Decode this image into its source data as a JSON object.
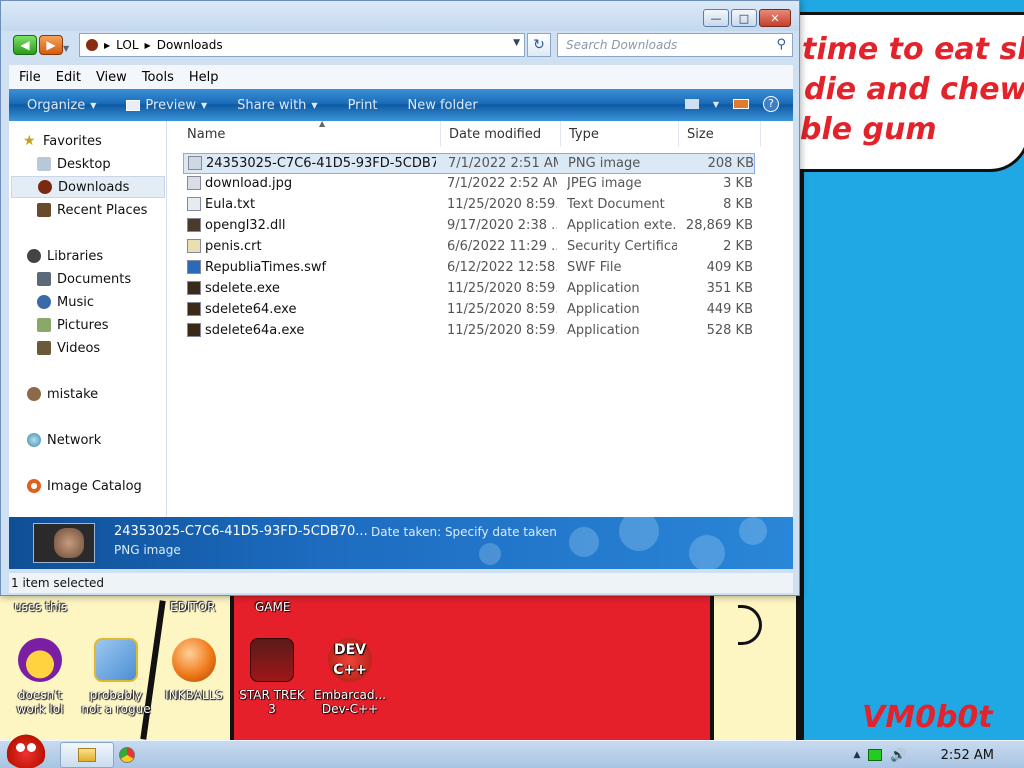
{
  "wallpaper": {
    "top_text": [
      "time to eat shit",
      "die and chew",
      "ble gum"
    ],
    "signature": "VM0b0t",
    "captions": [
      "uses this",
      "EDITOR",
      "GAME"
    ]
  },
  "desktop_icons": [
    {
      "label_lines": [
        "doesn't",
        "work lol"
      ],
      "icon": "yahoo-messenger-icon",
      "color": "#7a1fa3"
    },
    {
      "label_lines": [
        "probably",
        "not a rogue"
      ],
      "icon": "gears-monitor-icon",
      "color": "#4a8fd4"
    },
    {
      "label_lines": [
        "INKBALLS",
        ""
      ],
      "icon": "inkball-icon",
      "color": "#f07a1a"
    },
    {
      "label_lines": [
        "STAR TREK",
        "3"
      ],
      "icon": "star-wars-game-icon",
      "color": "#a01818"
    },
    {
      "label_lines": [
        "Embarcad...",
        "Dev-C++"
      ],
      "icon": "devcpp-icon",
      "color": "#d8281e"
    }
  ],
  "window": {
    "address_path": [
      "LOL",
      "Downloads"
    ],
    "search_placeholder": "Search Downloads",
    "menu": [
      "File",
      "Edit",
      "View",
      "Tools",
      "Help"
    ],
    "commands": [
      "Organize",
      "Preview",
      "Share with",
      "Print",
      "New folder"
    ],
    "nav": {
      "favorites_label": "Favorites",
      "favorites": [
        "Desktop",
        "Downloads",
        "Recent Places"
      ],
      "libraries_label": "Libraries",
      "libraries": [
        "Documents",
        "Music",
        "Pictures",
        "Videos"
      ],
      "other": [
        "mistake",
        "Network",
        "Image Catalog"
      ]
    },
    "columns": {
      "name": "Name",
      "date": "Date modified",
      "type": "Type",
      "size": "Size"
    },
    "files": [
      {
        "name": "24353025-C7C6-41D5-93FD-5CDB70...",
        "date": "7/1/2022 2:51 AM",
        "type": "PNG image",
        "size": "208 KB",
        "icon": "png-file-icon"
      },
      {
        "name": "download.jpg",
        "date": "7/1/2022 2:52 AM",
        "type": "JPEG image",
        "size": "3 KB",
        "icon": "jpg-file-icon"
      },
      {
        "name": "Eula.txt",
        "date": "11/25/2020 8:59...",
        "type": "Text Document",
        "size": "8 KB",
        "icon": "txt-file-icon"
      },
      {
        "name": "opengl32.dll",
        "date": "9/17/2020 2:38 ...",
        "type": "Application exte...",
        "size": "28,869 KB",
        "icon": "dll-file-icon"
      },
      {
        "name": "penis.crt",
        "date": "6/6/2022 11:29 ...",
        "type": "Security Certifica...",
        "size": "2 KB",
        "icon": "certificate-file-icon"
      },
      {
        "name": "RepubliaTimes.swf",
        "date": "6/12/2022 12:58...",
        "type": "SWF File",
        "size": "409 KB",
        "icon": "swf-file-icon"
      },
      {
        "name": "sdelete.exe",
        "date": "11/25/2020 8:59...",
        "type": "Application",
        "size": "351 KB",
        "icon": "exe-file-icon"
      },
      {
        "name": "sdelete64.exe",
        "date": "11/25/2020 8:59...",
        "type": "Application",
        "size": "449 KB",
        "icon": "exe-file-icon"
      },
      {
        "name": "sdelete64a.exe",
        "date": "11/25/2020 8:59...",
        "type": "Application",
        "size": "528 KB",
        "icon": "exe-file-icon"
      }
    ],
    "selected_index": 0,
    "details": {
      "name": "24353025-C7C6-41D5-93FD-5CDB70...",
      "date_taken_label": "Date taken:",
      "date_taken_value": "Specify date taken",
      "type": "PNG image"
    },
    "status": "1 item selected"
  },
  "taskbar": {
    "clock": "2:52 AM"
  },
  "colors": {
    "wallpaper_blue": "#1fa8e4",
    "wallpaper_red": "#e6202b",
    "wallpaper_yellow": "#fdf5c2",
    "command_bar": "#1a6cb8"
  }
}
